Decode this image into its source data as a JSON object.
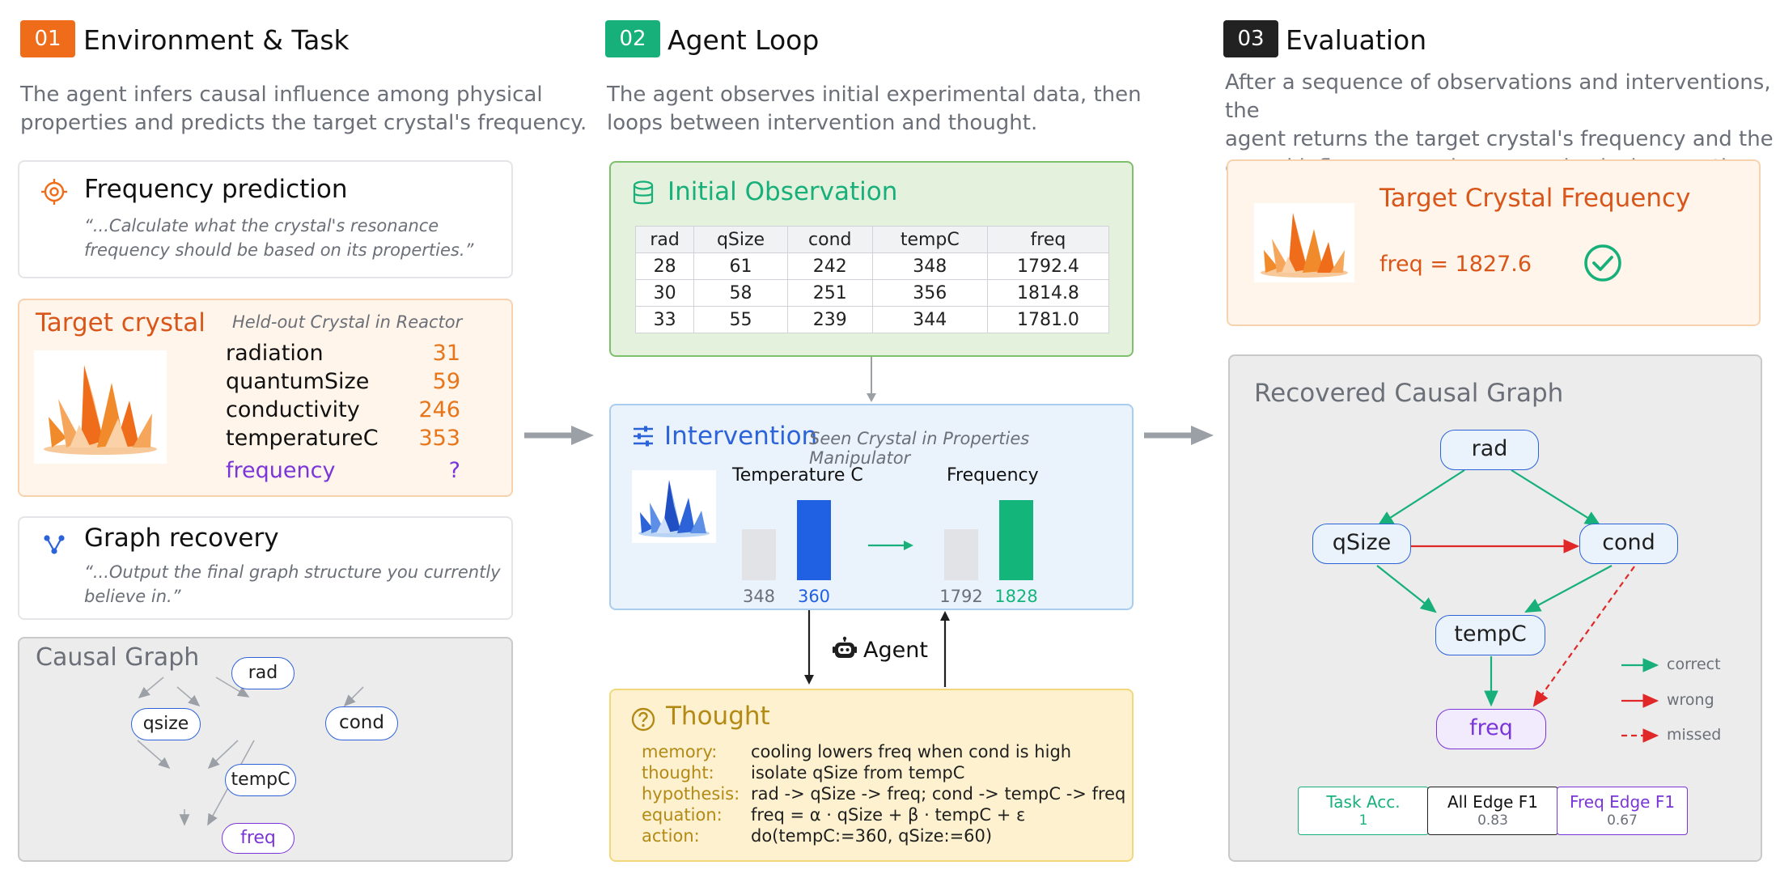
{
  "columns": {
    "env": {
      "badge": "01",
      "title": "Environment & Task",
      "desc_line1": "The agent infers causal influence among physical",
      "desc_line2": "properties and predicts the target crystal's frequency.",
      "badge_color": "#ef6c1a"
    },
    "loop": {
      "badge": "02",
      "title": "Agent Loop",
      "desc_line1": "The agent observes initial experimental data, then",
      "desc_line2": "loops between intervention and thought.",
      "badge_color": "#17b07a"
    },
    "eval": {
      "badge": "03",
      "title": "Evaluation",
      "desc_line1": "After a sequence of observations and interventions, the",
      "desc_line2": "agent returns the target crystal's frequency and the",
      "desc_line3": "causal influence graph among physical properties.",
      "badge_color": "#222222"
    }
  },
  "freq_task": {
    "title": "Frequency prediction",
    "quote_line1": "“...Calculate what the crystal's resonance",
    "quote_line2": "frequency should be based on its properties.”",
    "icon": "target-icon"
  },
  "target_crystal": {
    "title": "Target crystal",
    "subtitle": "Held-out Crystal in Reactor",
    "icon": "crystal-icon",
    "properties": [
      {
        "name": "radiation",
        "value": "31"
      },
      {
        "name": "quantumSize",
        "value": "59"
      },
      {
        "name": "conductivity",
        "value": "246"
      },
      {
        "name": "temperatureC",
        "value": "353"
      }
    ],
    "frequency": {
      "name": "frequency",
      "value": "?"
    }
  },
  "graph_task": {
    "title": "Graph recovery",
    "quote_line1": "“...Output the final graph structure you currently",
    "quote_line2": "believe in.”",
    "icon": "graph-icon"
  },
  "causal_graph": {
    "title": "Causal Graph",
    "nodes": {
      "rad": "rad",
      "qsize": "qsize",
      "cond": "cond",
      "tempc": "tempC",
      "freq": "freq"
    }
  },
  "initial_observation": {
    "title": "Initial Observation",
    "icon": "database-icon",
    "columns": [
      "rad",
      "qSize",
      "cond",
      "tempC",
      "freq"
    ],
    "rows": [
      [
        "28",
        "61",
        "242",
        "348",
        "1792.4"
      ],
      [
        "30",
        "58",
        "251",
        "356",
        "1814.8"
      ],
      [
        "33",
        "55",
        "239",
        "344",
        "1781.0"
      ]
    ]
  },
  "intervention": {
    "title": "Intervention",
    "subtitle": "Seen Crystal in Properties Manipulator",
    "icon": "sliders-icon",
    "temp_label": "Temperature C",
    "freq_label": "Frequency",
    "temp_before": "348",
    "temp_after": "360",
    "freq_before": "1792",
    "freq_after": "1828"
  },
  "agent_label": "Agent",
  "thought": {
    "title": "Thought",
    "icon": "question-icon",
    "rows": [
      {
        "key": "memory:",
        "value": "cooling lowers freq when cond is high"
      },
      {
        "key": "thought:",
        "value": "isolate qSize from tempC"
      },
      {
        "key": "hypothesis:",
        "value": "rad -> qSize -> freq; cond -> tempC -> freq"
      },
      {
        "key": "equation:",
        "value": "freq = α  · qSize + β  · tempC + ε"
      },
      {
        "key": "action:",
        "value": "do(tempC:=360, qSize:=60)"
      }
    ]
  },
  "target_frequency": {
    "title": "Target Crystal Frequency",
    "value": "freq = 1827.6",
    "icon": "check-circle-icon"
  },
  "recovered_graph": {
    "title": "Recovered Causal Graph",
    "nodes": {
      "rad": "rad",
      "qsize": "qSize",
      "cond": "cond",
      "tempc": "tempC",
      "freq": "freq"
    },
    "legend": {
      "correct": "correct",
      "wrong": "wrong",
      "missed": "missed"
    },
    "colors": {
      "correct": "#17b07a",
      "wrong": "#e02828",
      "missed": "#e02828"
    }
  },
  "metrics": [
    {
      "label": "Task Acc.",
      "value": "1"
    },
    {
      "label": "All Edge F1",
      "value": "0.83"
    },
    {
      "label": "Freq Edge F1",
      "value": "0.67"
    }
  ]
}
